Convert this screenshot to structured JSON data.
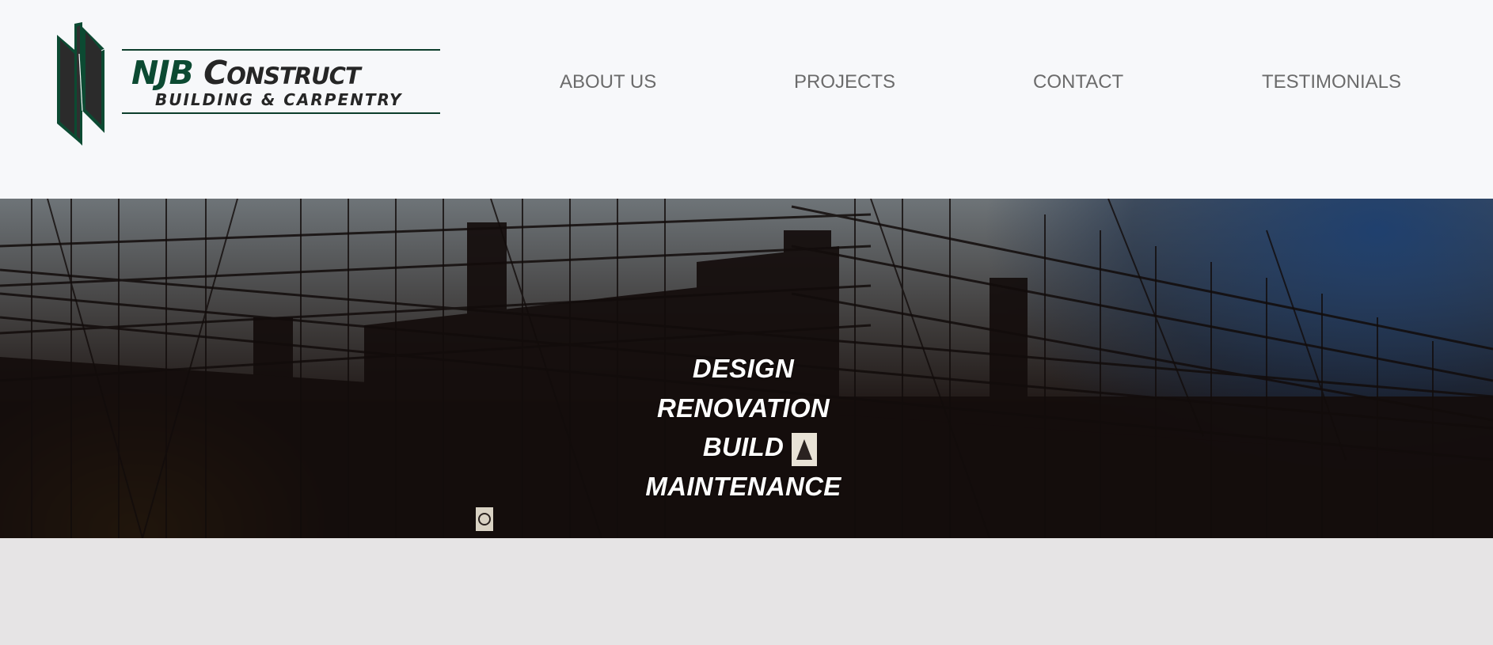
{
  "logo": {
    "title_part1": "NJB",
    "title_part2": "Construct",
    "subtitle": "BUILDING & CARPENTRY"
  },
  "nav": {
    "items": [
      {
        "label": "ABOUT US"
      },
      {
        "label": "PROJECTS"
      },
      {
        "label": "CONTACT"
      },
      {
        "label": "TESTIMONIALS"
      }
    ]
  },
  "hero": {
    "lines": [
      "DESIGN",
      "RENOVATION",
      "BUILD",
      "MAINTENANCE"
    ],
    "image": "construction-scaffolding-silhouette"
  },
  "colors": {
    "brand_green": "#0c4a32",
    "nav_text": "#6b6b6b",
    "header_bg": "#f7f8fa",
    "footer_bg": "#e6e4e5"
  }
}
